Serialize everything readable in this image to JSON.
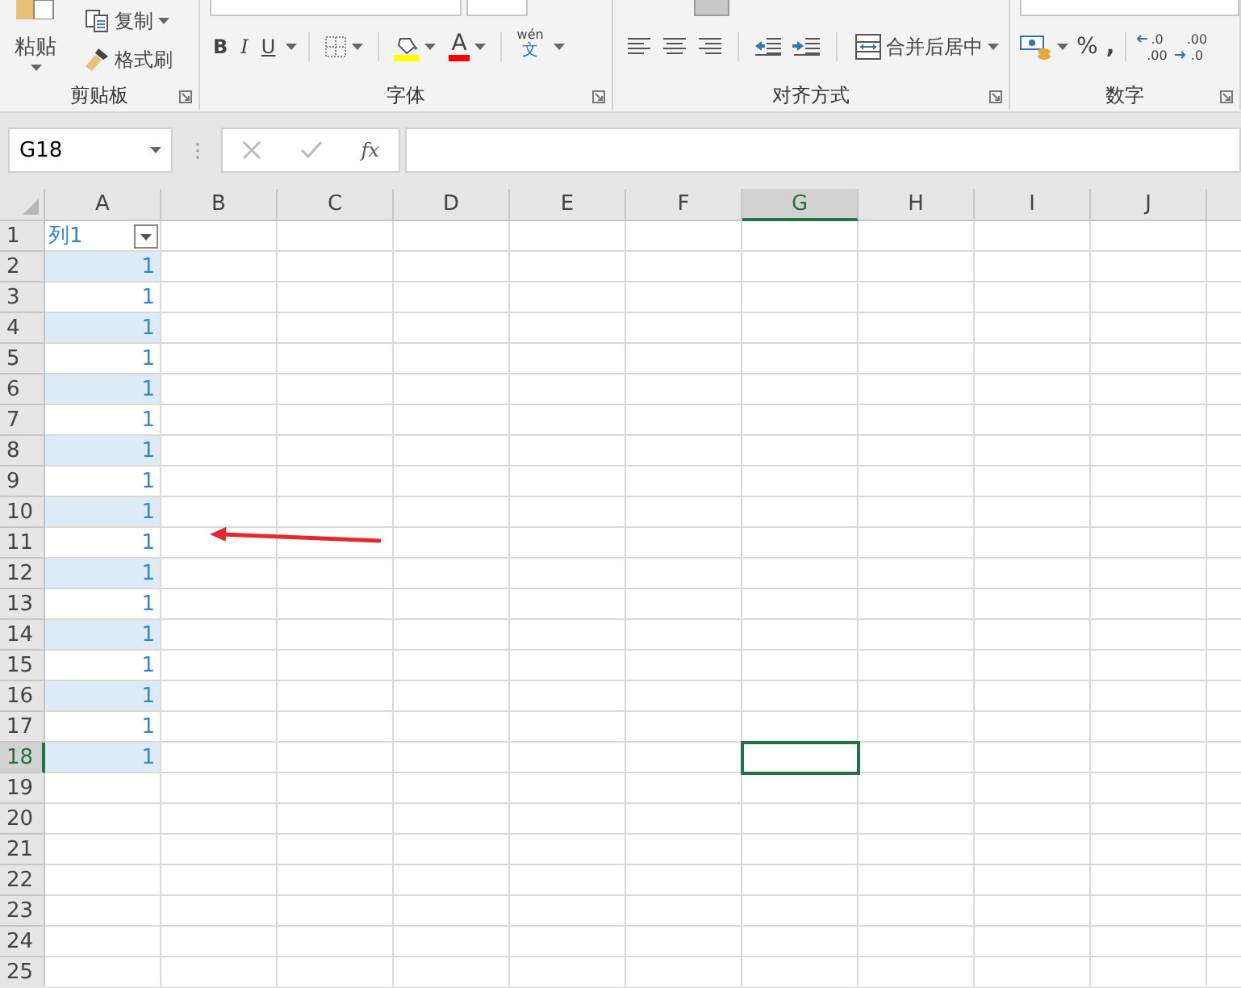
{
  "ribbon": {
    "groups": [
      {
        "kind": "clipboard",
        "label": "剪贴板",
        "paste": "粘贴",
        "copy": "复制",
        "format_painter": "格式刷"
      },
      {
        "kind": "font",
        "label": "字体",
        "bold": "B",
        "italic": "I",
        "underline": "U",
        "font_color": "A",
        "phonetic": "wén",
        "phonetic_char": "文"
      },
      {
        "kind": "alignment",
        "label": "对齐方式",
        "merge": "合并后居中"
      },
      {
        "kind": "number",
        "label": "数字",
        "percent": "%",
        "comma": ",",
        "increase_decimal": [
          ".0",
          ".00"
        ],
        "decrease_decimal": [
          ".00",
          ".0"
        ]
      }
    ]
  },
  "formula_bar": {
    "name_box": "G18",
    "function_label": "fx"
  },
  "sheet": {
    "columns": [
      {
        "label": "A",
        "selected": false
      },
      {
        "label": "B",
        "selected": false
      },
      {
        "label": "C",
        "selected": false
      },
      {
        "label": "D",
        "selected": false
      },
      {
        "label": "E",
        "selected": false
      },
      {
        "label": "F",
        "selected": false
      },
      {
        "label": "G",
        "selected": true
      },
      {
        "label": "H",
        "selected": false
      },
      {
        "label": "I",
        "selected": false
      },
      {
        "label": "J",
        "selected": false
      }
    ],
    "rows": [
      {
        "label": "1",
        "selected": false
      },
      {
        "label": "2",
        "selected": false
      },
      {
        "label": "3",
        "selected": false
      },
      {
        "label": "4",
        "selected": false
      },
      {
        "label": "5",
        "selected": false
      },
      {
        "label": "6",
        "selected": false
      },
      {
        "label": "7",
        "selected": false
      },
      {
        "label": "8",
        "selected": false
      },
      {
        "label": "9",
        "selected": false
      },
      {
        "label": "10",
        "selected": false
      },
      {
        "label": "11",
        "selected": false
      },
      {
        "label": "12",
        "selected": false
      },
      {
        "label": "13",
        "selected": false
      },
      {
        "label": "14",
        "selected": false
      },
      {
        "label": "15",
        "selected": false
      },
      {
        "label": "16",
        "selected": false
      },
      {
        "label": "17",
        "selected": false
      },
      {
        "label": "18",
        "selected": true
      },
      {
        "label": "19",
        "selected": false
      },
      {
        "label": "20",
        "selected": false
      },
      {
        "label": "21",
        "selected": false
      },
      {
        "label": "22",
        "selected": false
      },
      {
        "label": "23",
        "selected": false
      },
      {
        "label": "24",
        "selected": false
      },
      {
        "label": "25",
        "selected": false
      }
    ],
    "table": {
      "header": "列1",
      "values": [
        {
          "text": "1",
          "banded": true
        },
        {
          "text": "1",
          "banded": false
        },
        {
          "text": "1",
          "banded": true
        },
        {
          "text": "1",
          "banded": false
        },
        {
          "text": "1",
          "banded": true
        },
        {
          "text": "1",
          "banded": false
        },
        {
          "text": "1",
          "banded": true
        },
        {
          "text": "1",
          "banded": false
        },
        {
          "text": "1",
          "banded": true
        },
        {
          "text": "1",
          "banded": false
        },
        {
          "text": "1",
          "banded": true
        },
        {
          "text": "1",
          "banded": false
        },
        {
          "text": "1",
          "banded": true
        },
        {
          "text": "1",
          "banded": false
        },
        {
          "text": "1",
          "banded": true
        },
        {
          "text": "1",
          "banded": false
        },
        {
          "text": "1",
          "banded": true
        }
      ]
    }
  },
  "annotations": [
    {
      "kind": "arrow"
    }
  ]
}
